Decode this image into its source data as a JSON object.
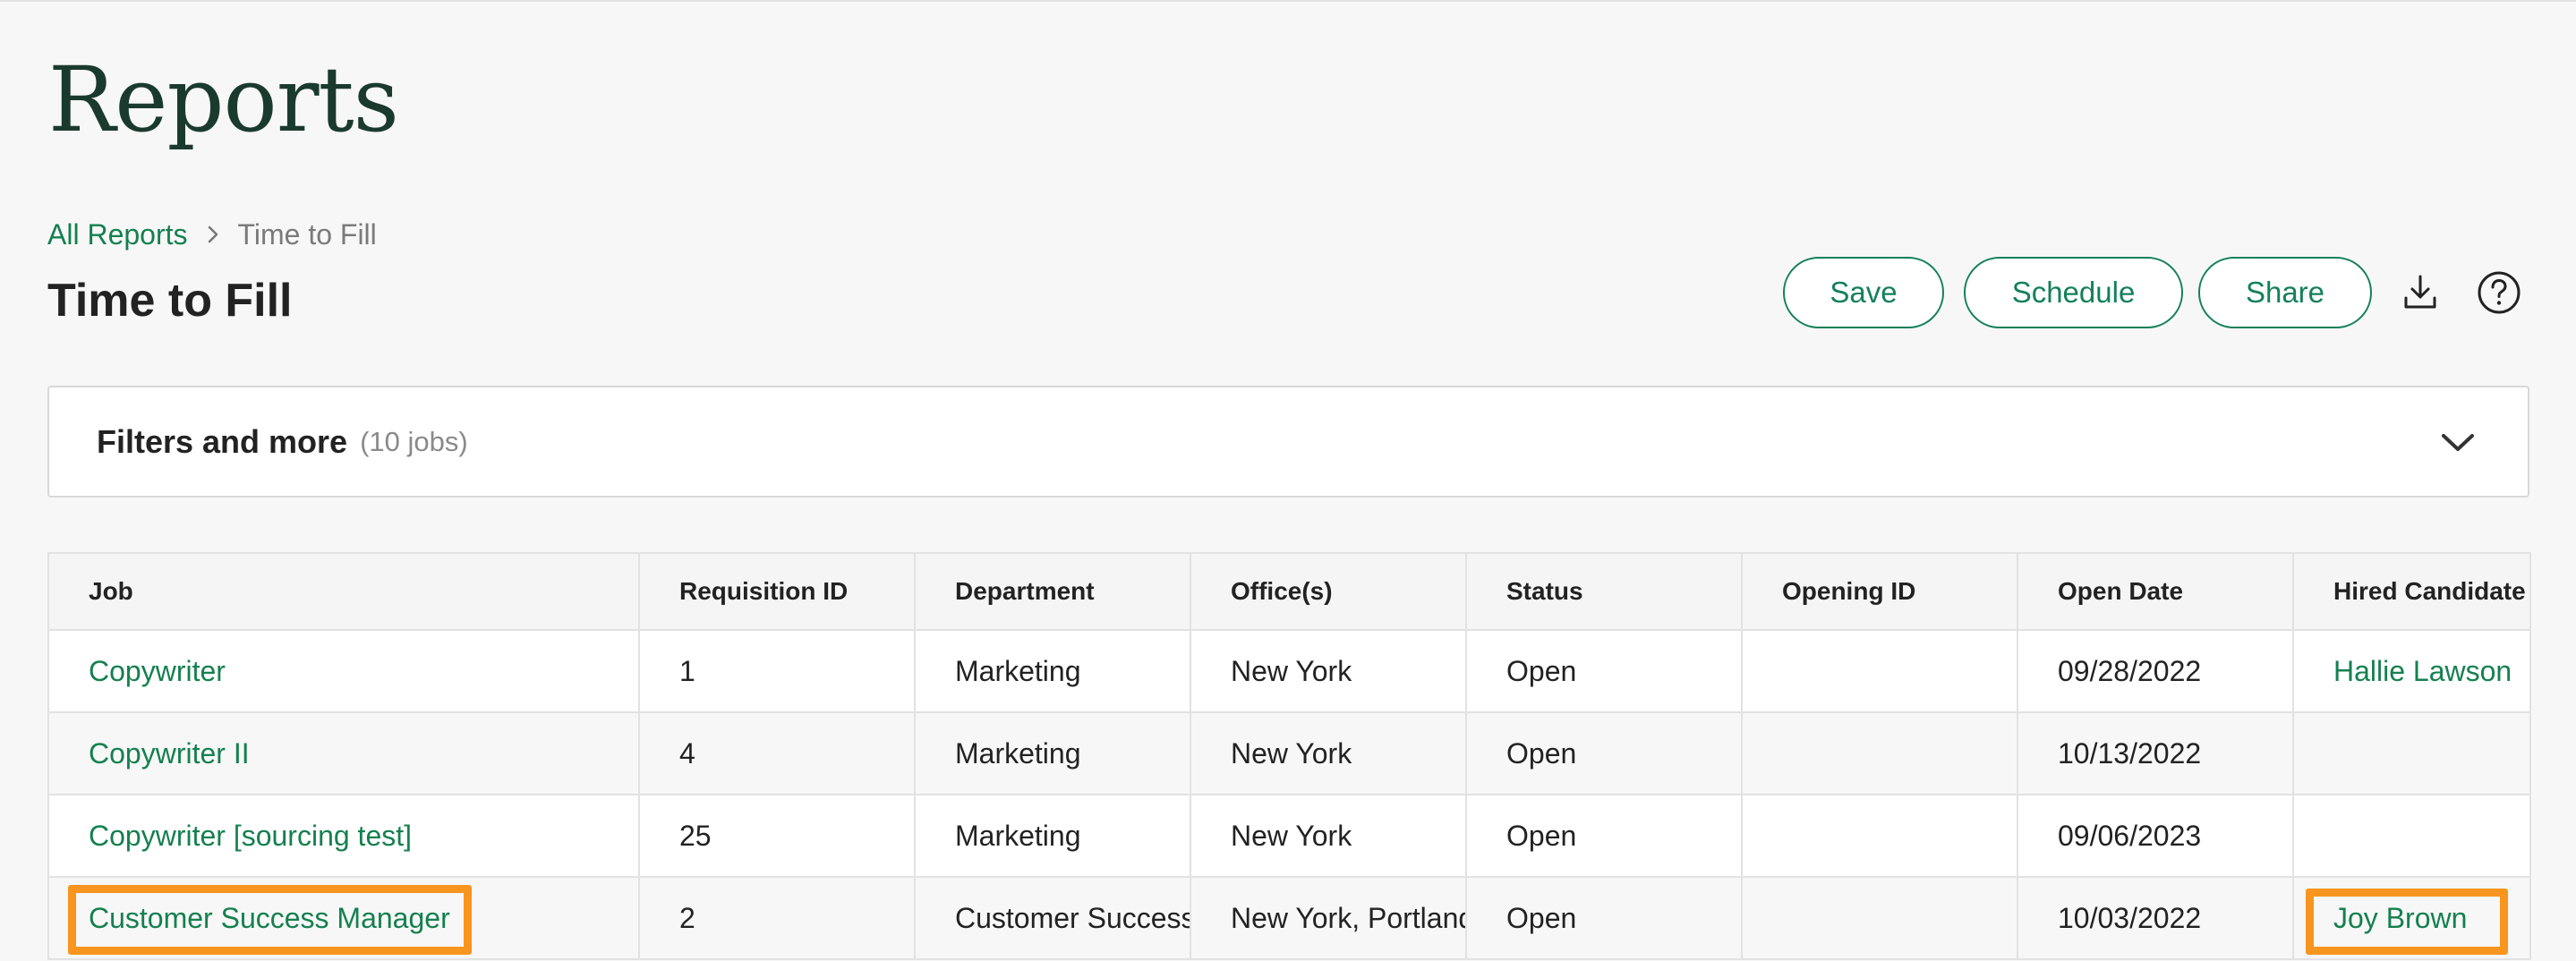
{
  "page": {
    "heading": "Reports"
  },
  "breadcrumb": {
    "parent": "All Reports",
    "current": "Time to Fill"
  },
  "report": {
    "title": "Time to Fill"
  },
  "actions": {
    "save": "Save",
    "schedule": "Schedule",
    "share": "Share",
    "download_icon": "download-icon",
    "help_icon": "question-circle-icon"
  },
  "filters": {
    "label": "Filters and more",
    "count": "(10 jobs)",
    "expand_icon": "chevron-down-icon"
  },
  "table": {
    "columns": [
      "Job",
      "Requisition ID",
      "Department",
      "Office(s)",
      "Status",
      "Opening ID",
      "Open Date",
      "Hired Candidate"
    ],
    "rows": [
      {
        "job": "Copywriter",
        "requisition_id": "1",
        "department": "Marketing",
        "offices": "New York",
        "status": "Open",
        "opening_id": "",
        "open_date": "09/28/2022",
        "hired_candidate": "Hallie Lawson"
      },
      {
        "job": "Copywriter II",
        "requisition_id": "4",
        "department": "Marketing",
        "offices": "New York",
        "status": "Open",
        "opening_id": "",
        "open_date": "10/13/2022",
        "hired_candidate": ""
      },
      {
        "job": "Copywriter [sourcing test]",
        "requisition_id": "25",
        "department": "Marketing",
        "offices": "New York",
        "status": "Open",
        "opening_id": "",
        "open_date": "09/06/2023",
        "hired_candidate": ""
      },
      {
        "job": "Customer Success Manager",
        "requisition_id": "2",
        "department": "Customer Success",
        "offices": "New York, Portland",
        "status": "Open",
        "opening_id": "",
        "open_date": "10/03/2022",
        "hired_candidate": "Joy Brown"
      }
    ]
  },
  "colors": {
    "brand_green": "#15804f",
    "heading_green": "#1b3a2e",
    "highlight_orange": "#f7951e"
  }
}
